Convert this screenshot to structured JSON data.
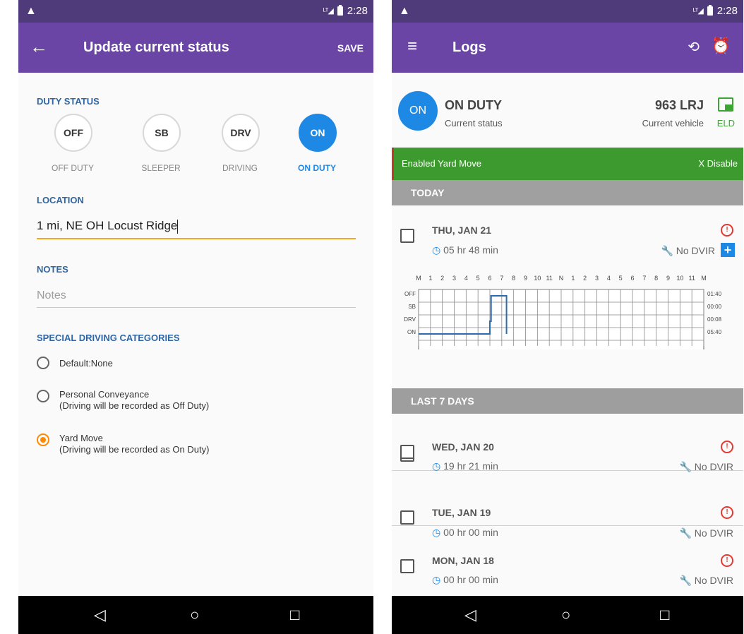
{
  "status_bar": {
    "time": "2:28"
  },
  "status_screen": {
    "title": "Update current status",
    "save_label": "SAVE",
    "duty_status_heading": "DUTY STATUS",
    "duty_options": [
      {
        "code": "OFF",
        "label": "OFF DUTY",
        "selected": false
      },
      {
        "code": "SB",
        "label": "SLEEPER",
        "selected": false
      },
      {
        "code": "DRV",
        "label": "DRIVING",
        "selected": false
      },
      {
        "code": "ON",
        "label": "ON DUTY",
        "selected": true
      }
    ],
    "location_heading": "LOCATION",
    "location_value": "1 mi, NE OH Locust Ridge",
    "notes_heading": "NOTES",
    "notes_placeholder": "Notes",
    "special_heading": "SPECIAL DRIVING CATEGORIES",
    "special_options": [
      {
        "label": "Default:None",
        "sub": "",
        "selected": false
      },
      {
        "label": "Personal Conveyance",
        "sub": "(Driving will be recorded as Off Duty)",
        "selected": false
      },
      {
        "label": "Yard Move",
        "sub": "(Driving will be recorded as On Duty)",
        "selected": true
      }
    ]
  },
  "logs_screen": {
    "title": "Logs",
    "status_circle": "ON",
    "status_title": "ON DUTY",
    "status_sub": "Current status",
    "vehicle": "963 LRJ",
    "vehicle_sub": "Current vehicle",
    "eld_label": "ELD",
    "yard_banner": "Enabled Yard Move",
    "disable_label": "X Disable",
    "today_heading": "TODAY",
    "today": {
      "date": "THU, JAN 21",
      "duration": "05 hr  48 min",
      "dvir": "No DVIR"
    },
    "graph": {
      "hour_labels": [
        "M",
        "1",
        "2",
        "3",
        "4",
        "5",
        "6",
        "7",
        "8",
        "9",
        "10",
        "11",
        "N",
        "1",
        "2",
        "3",
        "4",
        "5",
        "6",
        "7",
        "8",
        "9",
        "10",
        "11",
        "M"
      ],
      "row_labels": [
        "OFF",
        "SB",
        "DRV",
        "ON"
      ],
      "totals": [
        "01:40",
        "00:00",
        "00:08",
        "05:40"
      ]
    },
    "last7_heading": "LAST 7 DAYS",
    "days": [
      {
        "date": "WED, JAN 20",
        "duration": "19 hr  21 min",
        "dvir": "No DVIR"
      },
      {
        "date": "TUE, JAN 19",
        "duration": "00 hr  00 min",
        "dvir": "No DVIR"
      },
      {
        "date": "MON, JAN 18",
        "duration": "00 hr  00 min",
        "dvir": "No DVIR"
      }
    ]
  },
  "colors": {
    "appbar": "#6a45a6",
    "accent_blue": "#1e88e5",
    "banner_green": "#3d9a2e",
    "alert_red": "#e53935",
    "radio_orange": "#ff8a00"
  }
}
